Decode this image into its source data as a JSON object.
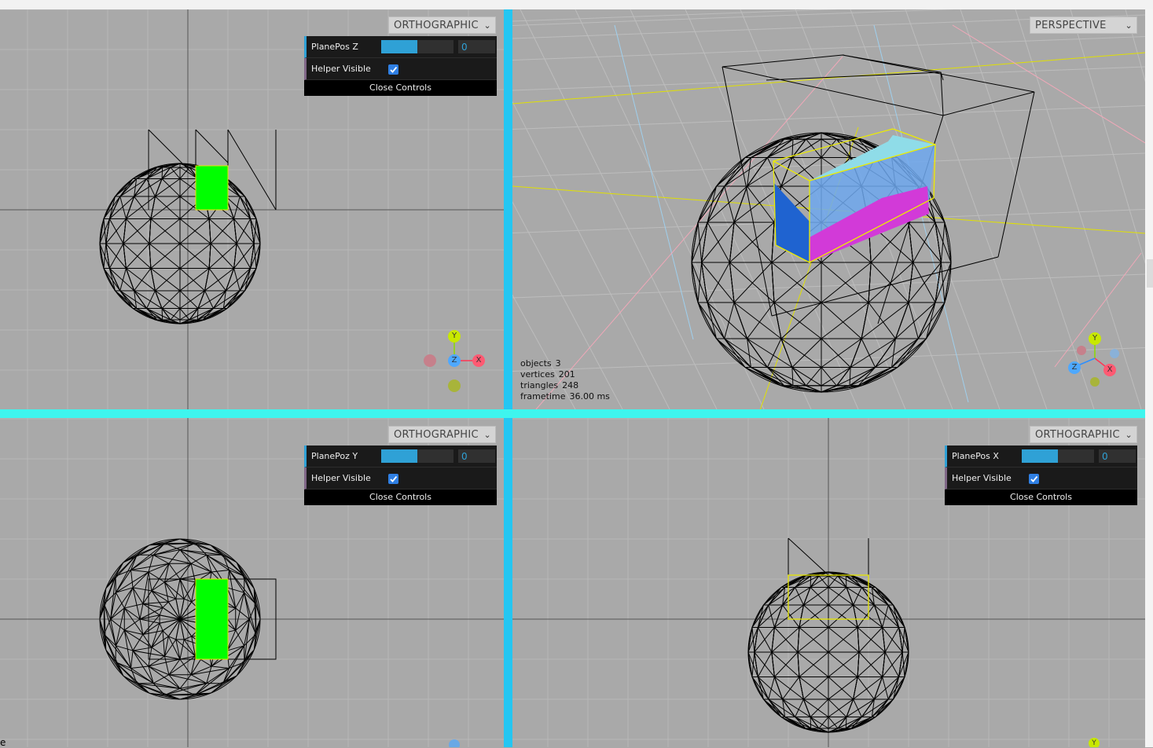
{
  "views": {
    "top_left": {
      "camera": "ORTHOGRAPHIC",
      "plane_label": "PlanePos Z",
      "plane_value": "0",
      "slider_fraction": 0.5,
      "helper_label": "Helper Visible",
      "helper_visible": true,
      "close_label": "Close Controls"
    },
    "top_right": {
      "camera": "PERSPECTIVE"
    },
    "bottom_left": {
      "camera": "ORTHOGRAPHIC",
      "plane_label": "PlanePoz Y",
      "plane_value": "0",
      "slider_fraction": 0.5,
      "helper_label": "Helper Visible",
      "helper_visible": true,
      "close_label": "Close Controls"
    },
    "bottom_right": {
      "camera": "ORTHOGRAPHIC",
      "plane_label": "PlanePos X",
      "plane_value": "0",
      "slider_fraction": 0.5,
      "helper_label": "Helper Visible",
      "helper_visible": true,
      "close_label": "Close Controls"
    }
  },
  "stats": {
    "objects_label": "objects",
    "objects": "3",
    "vertices_label": "vertices",
    "vertices": "201",
    "triangles_label": "triangles",
    "triangles": "248",
    "frametime_label": "frametime",
    "frametime": "36.00 ms"
  },
  "axes": {
    "x": "X",
    "y": "Y",
    "z": "Z"
  },
  "edge_text": "e",
  "colors": {
    "background": "#a9a9a9",
    "vertical_splitter": "#24c6f2",
    "horizontal_splitter": "#3ef5ee",
    "cap_green": "#00ff00",
    "accent": "#2fa1d6",
    "x_axis": "#ff3653",
    "y_axis": "#8adb00",
    "z_axis": "#2c8fff"
  },
  "icons": [
    "chevron-down-icon",
    "checkbox-checked-icon",
    "axis-helper-icon"
  ]
}
